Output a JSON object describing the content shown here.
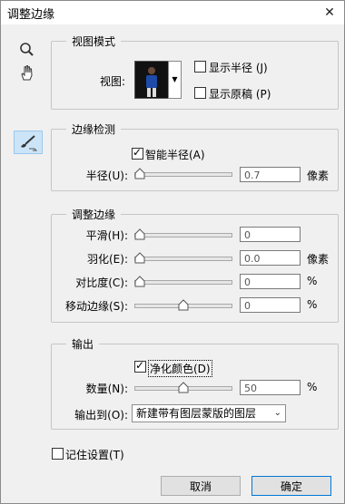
{
  "window": {
    "title": "调整边缘"
  },
  "icons": {
    "zoom": "magnifier-icon",
    "hand": "hand-icon",
    "brush": "refine-radius-brush-icon",
    "close": "close-icon"
  },
  "view_mode": {
    "legend": "视图模式",
    "view_label": "视图:",
    "show_radius": {
      "label": "显示半径 (J)",
      "checked": false
    },
    "show_original": {
      "label": "显示原稿 (P)",
      "checked": false
    }
  },
  "edge_detection": {
    "legend": "边缘检测",
    "smart_radius": {
      "label": "智能半径(A)",
      "checked": true
    },
    "radius": {
      "label": "半径(U):",
      "value": "0.7",
      "unit": "像素",
      "level": 0.0
    }
  },
  "adjust_edge": {
    "legend": "调整边缘",
    "smooth": {
      "label": "平滑(H):",
      "value": "0",
      "level": 0.0
    },
    "feather": {
      "label": "羽化(E):",
      "value": "0.0",
      "unit": "像素",
      "level": 0.0
    },
    "contrast": {
      "label": "对比度(C):",
      "value": "0",
      "unit": "%",
      "level": 0.0
    },
    "shift_edge": {
      "label": "移动边缘(S):",
      "value": "0",
      "unit": "%",
      "level": 0.5
    }
  },
  "output": {
    "legend": "输出",
    "decontaminate": {
      "label": "净化颜色(D)",
      "checked": true
    },
    "amount": {
      "label": "数量(N):",
      "value": "50",
      "unit": "%",
      "level": 0.5
    },
    "output_to_label": "输出到(O):",
    "output_to_value": "新建带有图层蒙版的图层"
  },
  "remember": {
    "label": "记住设置(T)",
    "checked": false
  },
  "buttons": {
    "cancel": "取消",
    "ok": "确定"
  }
}
